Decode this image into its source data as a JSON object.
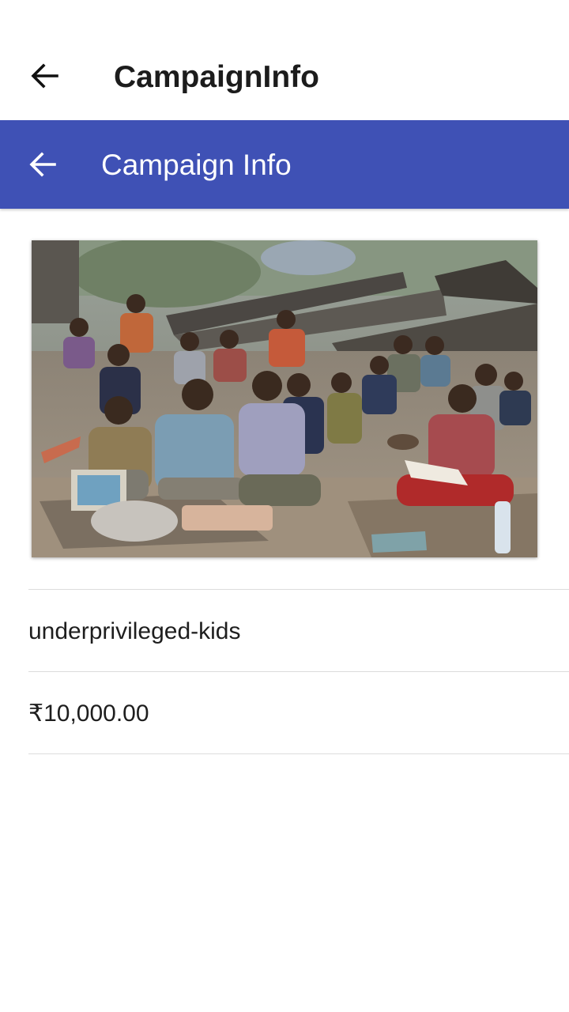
{
  "outer_bar": {
    "title": "CampaignInfo",
    "back_icon": "arrow-left-icon"
  },
  "toolbar": {
    "title": "Campaign Info",
    "back_icon": "arrow-left-icon",
    "color": "#3f51b5"
  },
  "campaign": {
    "image_icon": "campaign-photo",
    "name": "underprivileged-kids",
    "amount": "₹10,000.00"
  }
}
